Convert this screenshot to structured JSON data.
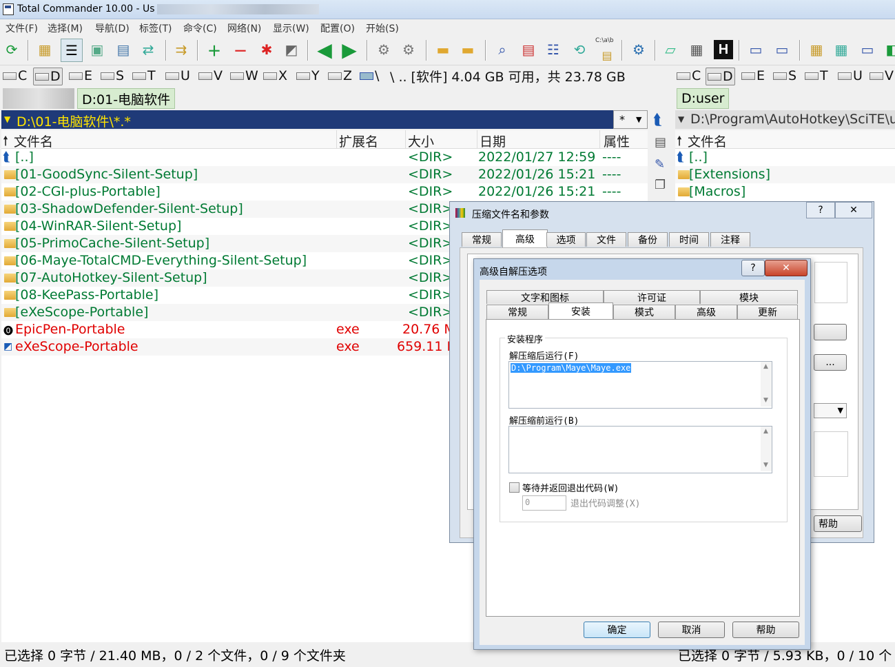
{
  "window": {
    "title": "Total Commander 10.00 - Us"
  },
  "menu": [
    "文件(F)",
    "选择(M)",
    "导航(D)",
    "标签(T)",
    "命令(C)",
    "网络(N)",
    "显示(W)",
    "配置(O)",
    "开始(S)"
  ],
  "toolbar": {
    "path_label": "C:\\a\\b"
  },
  "drives_left": [
    "C",
    "D",
    "E",
    "S",
    "T",
    "U",
    "V",
    "W",
    "X",
    "Y",
    "Z",
    "\\"
  ],
  "drives_right": [
    "C",
    "D",
    "E",
    "S",
    "T",
    "U",
    "V"
  ],
  "left_panel": {
    "dir_info": "\\  ..  [软件]  4.04 GB 可用，共 23.78 GB",
    "tab_active": "D:01-电脑软件",
    "path": "D:\\01-电脑软件\\*.*",
    "filter": "*",
    "columns": {
      "name": "文件名",
      "ext": "扩展名",
      "size": "大小",
      "date": "日期",
      "attr": "属性"
    },
    "rows": [
      {
        "name": "[..]",
        "ext": "",
        "size": "<DIR>",
        "date": "2022/01/27 12:59",
        "attr": "----"
      },
      {
        "name": "[01-GoodSync-Silent-Setup]",
        "ext": "",
        "size": "<DIR>",
        "date": "2022/01/26 15:21",
        "attr": "----"
      },
      {
        "name": "[02-CGI-plus-Portable]",
        "ext": "",
        "size": "<DIR>",
        "date": "2022/01/26 15:21",
        "attr": "----"
      },
      {
        "name": "[03-ShadowDefender-Silent-Setup]",
        "ext": "",
        "size": "<DIR>",
        "date": "",
        "attr": ""
      },
      {
        "name": "[04-WinRAR-Silent-Setup]",
        "ext": "",
        "size": "<DIR>",
        "date": "",
        "attr": ""
      },
      {
        "name": "[05-PrimoCache-Silent-Setup]",
        "ext": "",
        "size": "<DIR>",
        "date": "",
        "attr": ""
      },
      {
        "name": "[06-Maye-TotalCMD-Everything-Silent-Setup]",
        "ext": "",
        "size": "<DIR>",
        "date": "",
        "attr": ""
      },
      {
        "name": "[07-AutoHotkey-Silent-Setup]",
        "ext": "",
        "size": "<DIR>",
        "date": "",
        "attr": ""
      },
      {
        "name": "[08-KeePass-Portable]",
        "ext": "",
        "size": "<DIR>",
        "date": "",
        "attr": ""
      },
      {
        "name": "[eXeScope-Portable]",
        "ext": "",
        "size": "<DIR>",
        "date": "",
        "attr": ""
      },
      {
        "name": "EpicPen-Portable",
        "ext": "exe",
        "size": "20.76 M",
        "date": "",
        "attr": ""
      },
      {
        "name": "eXeScope-Portable",
        "ext": "exe",
        "size": "659.11 K",
        "date": "",
        "attr": ""
      }
    ],
    "status": "已选择 0 字节 / 21.40 MB，0 / 2 个文件，0 / 9 个文件夹"
  },
  "right_panel": {
    "tab_active": "D:user",
    "path": "D:\\Program\\AutoHotkey\\SciTE\\us",
    "columns": {
      "name": "文件名"
    },
    "rows": [
      "[..]",
      "[Extensions]",
      "[Macros]"
    ],
    "status": "已选择 0 字节 / 5.93 KB，0 / 10 个"
  },
  "dialog_archive": {
    "title": "压缩文件名和参数",
    "tabs": [
      "常规",
      "高级",
      "选项",
      "文件",
      "备份",
      "时间",
      "注释"
    ],
    "help_label": "帮助",
    "ellipsis_label": "..."
  },
  "dialog_sfx": {
    "title": "高级自解压选项",
    "tabs_row1": [
      "文字和图标",
      "许可证",
      "模块"
    ],
    "tabs_row2": [
      "常规",
      "安装",
      "模式",
      "高级",
      "更新"
    ],
    "group_label": "安装程序",
    "run_after_label": "解压缩后运行(F)",
    "run_after_value": "D:\\Program\\Maye\\Maye.exe",
    "run_before_label": "解压缩前运行(B)",
    "run_before_value": "",
    "wait_label": "等待并返回退出代码(W)",
    "exit_code_value": "0",
    "exit_code_label": "退出代码调整(X)",
    "ok_label": "确定",
    "cancel_label": "取消",
    "help_label": "帮助"
  }
}
